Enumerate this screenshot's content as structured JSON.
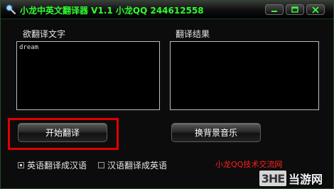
{
  "window": {
    "title": "小龙中英文翻译器 V1.1  小龙QQ 244612558"
  },
  "input_panel": {
    "label": "欲翻译文字",
    "value": "dream"
  },
  "output_panel": {
    "label": "翻译结果",
    "value": ""
  },
  "buttons": {
    "translate": "开始翻译",
    "change_bg_music": "换背景音乐"
  },
  "direction": {
    "options": [
      {
        "label": "英语翻译成汉语",
        "selected": true
      },
      {
        "label": "汉语翻译成英语",
        "selected": false
      }
    ]
  },
  "footer": {
    "link": "小龙QQ技术交流网"
  },
  "watermark": {
    "logo": "3HE",
    "text": "当游网"
  },
  "colors": {
    "title_green": "#2cff2c",
    "highlight_red": "#e00000",
    "link_red": "#ff2020"
  }
}
